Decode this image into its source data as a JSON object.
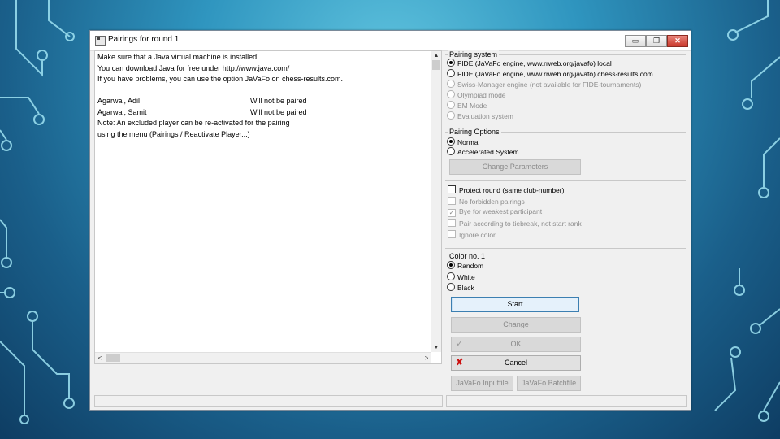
{
  "window": {
    "title": "Pairings for round 1",
    "minimize": "▭",
    "maximize": "❐",
    "close": "✕"
  },
  "log": {
    "intro": [
      "Make sure that a Java virtual machine is installed!",
      "You can download Java for free under http://www.java.com/",
      "If you have problems, you can use the option JaVaFo on chess-results.com."
    ],
    "unpaired": [
      {
        "name": "Agarwal, Adil",
        "status": "Will not be paired"
      },
      {
        "name": "Agarwal, Samit",
        "status": "Will not be paired"
      }
    ],
    "note": [
      "Note: An excluded player can be re-activated for the pairing",
      "using the menu (Pairings / Reactivate Player...)"
    ]
  },
  "pairing_system": {
    "title": "Pairing system",
    "options": [
      {
        "label": "FIDE (JaVaFo engine, www.rrweb.org/javafo) local",
        "checked": true,
        "enabled": true
      },
      {
        "label": "FIDE (JaVaFo engine, www.rrweb.org/javafo) chess-results.com",
        "checked": false,
        "enabled": true
      },
      {
        "label": "Swiss-Manager engine (not available for FIDE-tournaments)",
        "checked": false,
        "enabled": false
      },
      {
        "label": "Olympiad mode",
        "checked": false,
        "enabled": false
      },
      {
        "label": "EM Mode",
        "checked": false,
        "enabled": false
      },
      {
        "label": "Evaluation system",
        "checked": false,
        "enabled": false
      }
    ]
  },
  "pairing_options": {
    "title": "Pairing Options",
    "normal": "Normal",
    "accelerated": "Accelerated System",
    "change_parameters": "Change Parameters",
    "checks": [
      {
        "label": "Protect round (same club-number)",
        "checked": false,
        "enabled": true
      },
      {
        "label": "No forbidden pairings",
        "checked": false,
        "enabled": false
      },
      {
        "label": "Bye for weakest participant",
        "checked": true,
        "enabled": false
      },
      {
        "label": "Pair according to tiebreak, not start rank",
        "checked": false,
        "enabled": false
      },
      {
        "label": "Ignore color",
        "checked": false,
        "enabled": false
      }
    ]
  },
  "color": {
    "title": "Color no. 1",
    "random": "Random",
    "white": "White",
    "black": "Black"
  },
  "buttons": {
    "start": "Start",
    "change": "Change",
    "ok": "OK",
    "cancel": "Cancel",
    "inputfile": "JaVaFo Inputfile",
    "batchfile": "JaVaFo Batchfile"
  },
  "colors": {
    "cancel_icon": "#cc1010",
    "accent_focus": "#3c7fb1"
  }
}
